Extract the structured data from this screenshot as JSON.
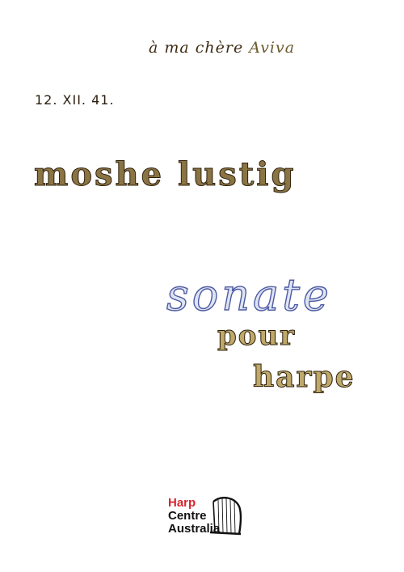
{
  "document": {
    "dedication_prefix": "à ma chère ",
    "dedication_name": "Aviva",
    "date": "12. XII. 41.",
    "composer": "moshe lustig",
    "title": "sonate",
    "subtitle_line1": "pour",
    "subtitle_line2": "harpe"
  },
  "logo": {
    "line1": "Harp",
    "line2": "Centre",
    "line3": "Australia",
    "icon": "harp-icon",
    "colors": {
      "accent": "#d6252c",
      "text": "#111111"
    }
  },
  "colors": {
    "ink_brown": "#4a3516",
    "ink_blue": "#4c5aa2",
    "background": "#ffffff"
  }
}
